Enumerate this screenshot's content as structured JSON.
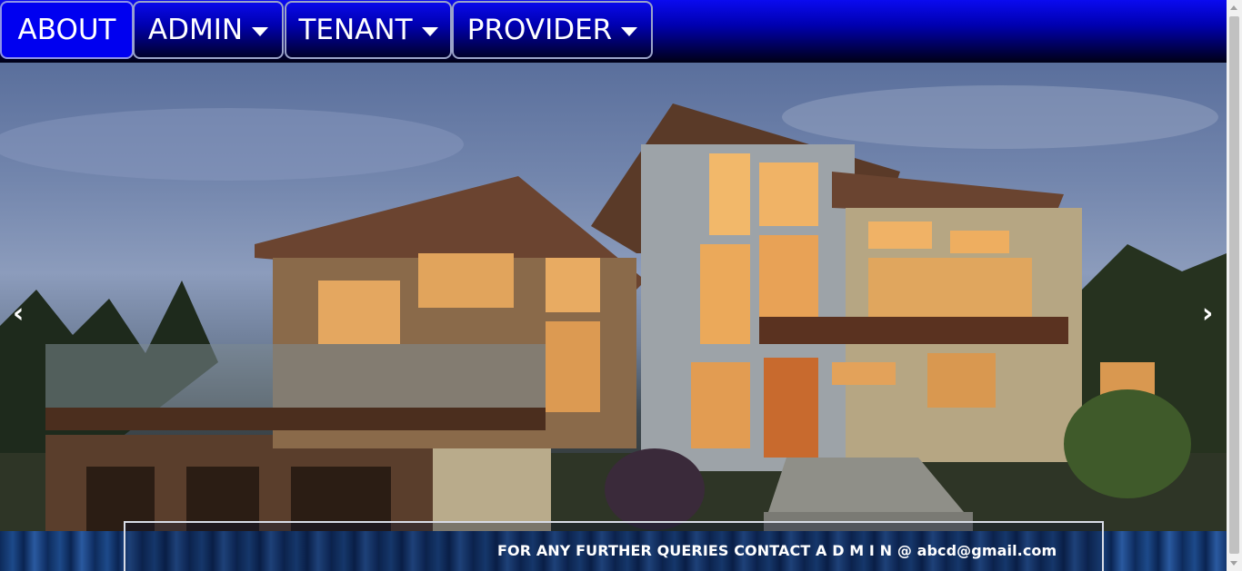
{
  "nav": {
    "items": [
      {
        "label": "ABOUT",
        "active": true,
        "dropdown": false
      },
      {
        "label": "ADMIN",
        "active": false,
        "dropdown": true
      },
      {
        "label": "TENANT",
        "active": false,
        "dropdown": true
      },
      {
        "label": "PROVIDER",
        "active": false,
        "dropdown": true
      }
    ]
  },
  "carousel": {
    "prev": "‹",
    "next": "›",
    "image": "modern-house-photo"
  },
  "footer": {
    "contact": "FOR ANY FURTHER QUERIES CONTACT A D M I N @ abcd@gmail.com"
  },
  "colors": {
    "nav_top": "#0a0af0",
    "nav_bottom": "#000015",
    "active_item": "#0000f0",
    "footer_blue": "#1d4a8a"
  }
}
